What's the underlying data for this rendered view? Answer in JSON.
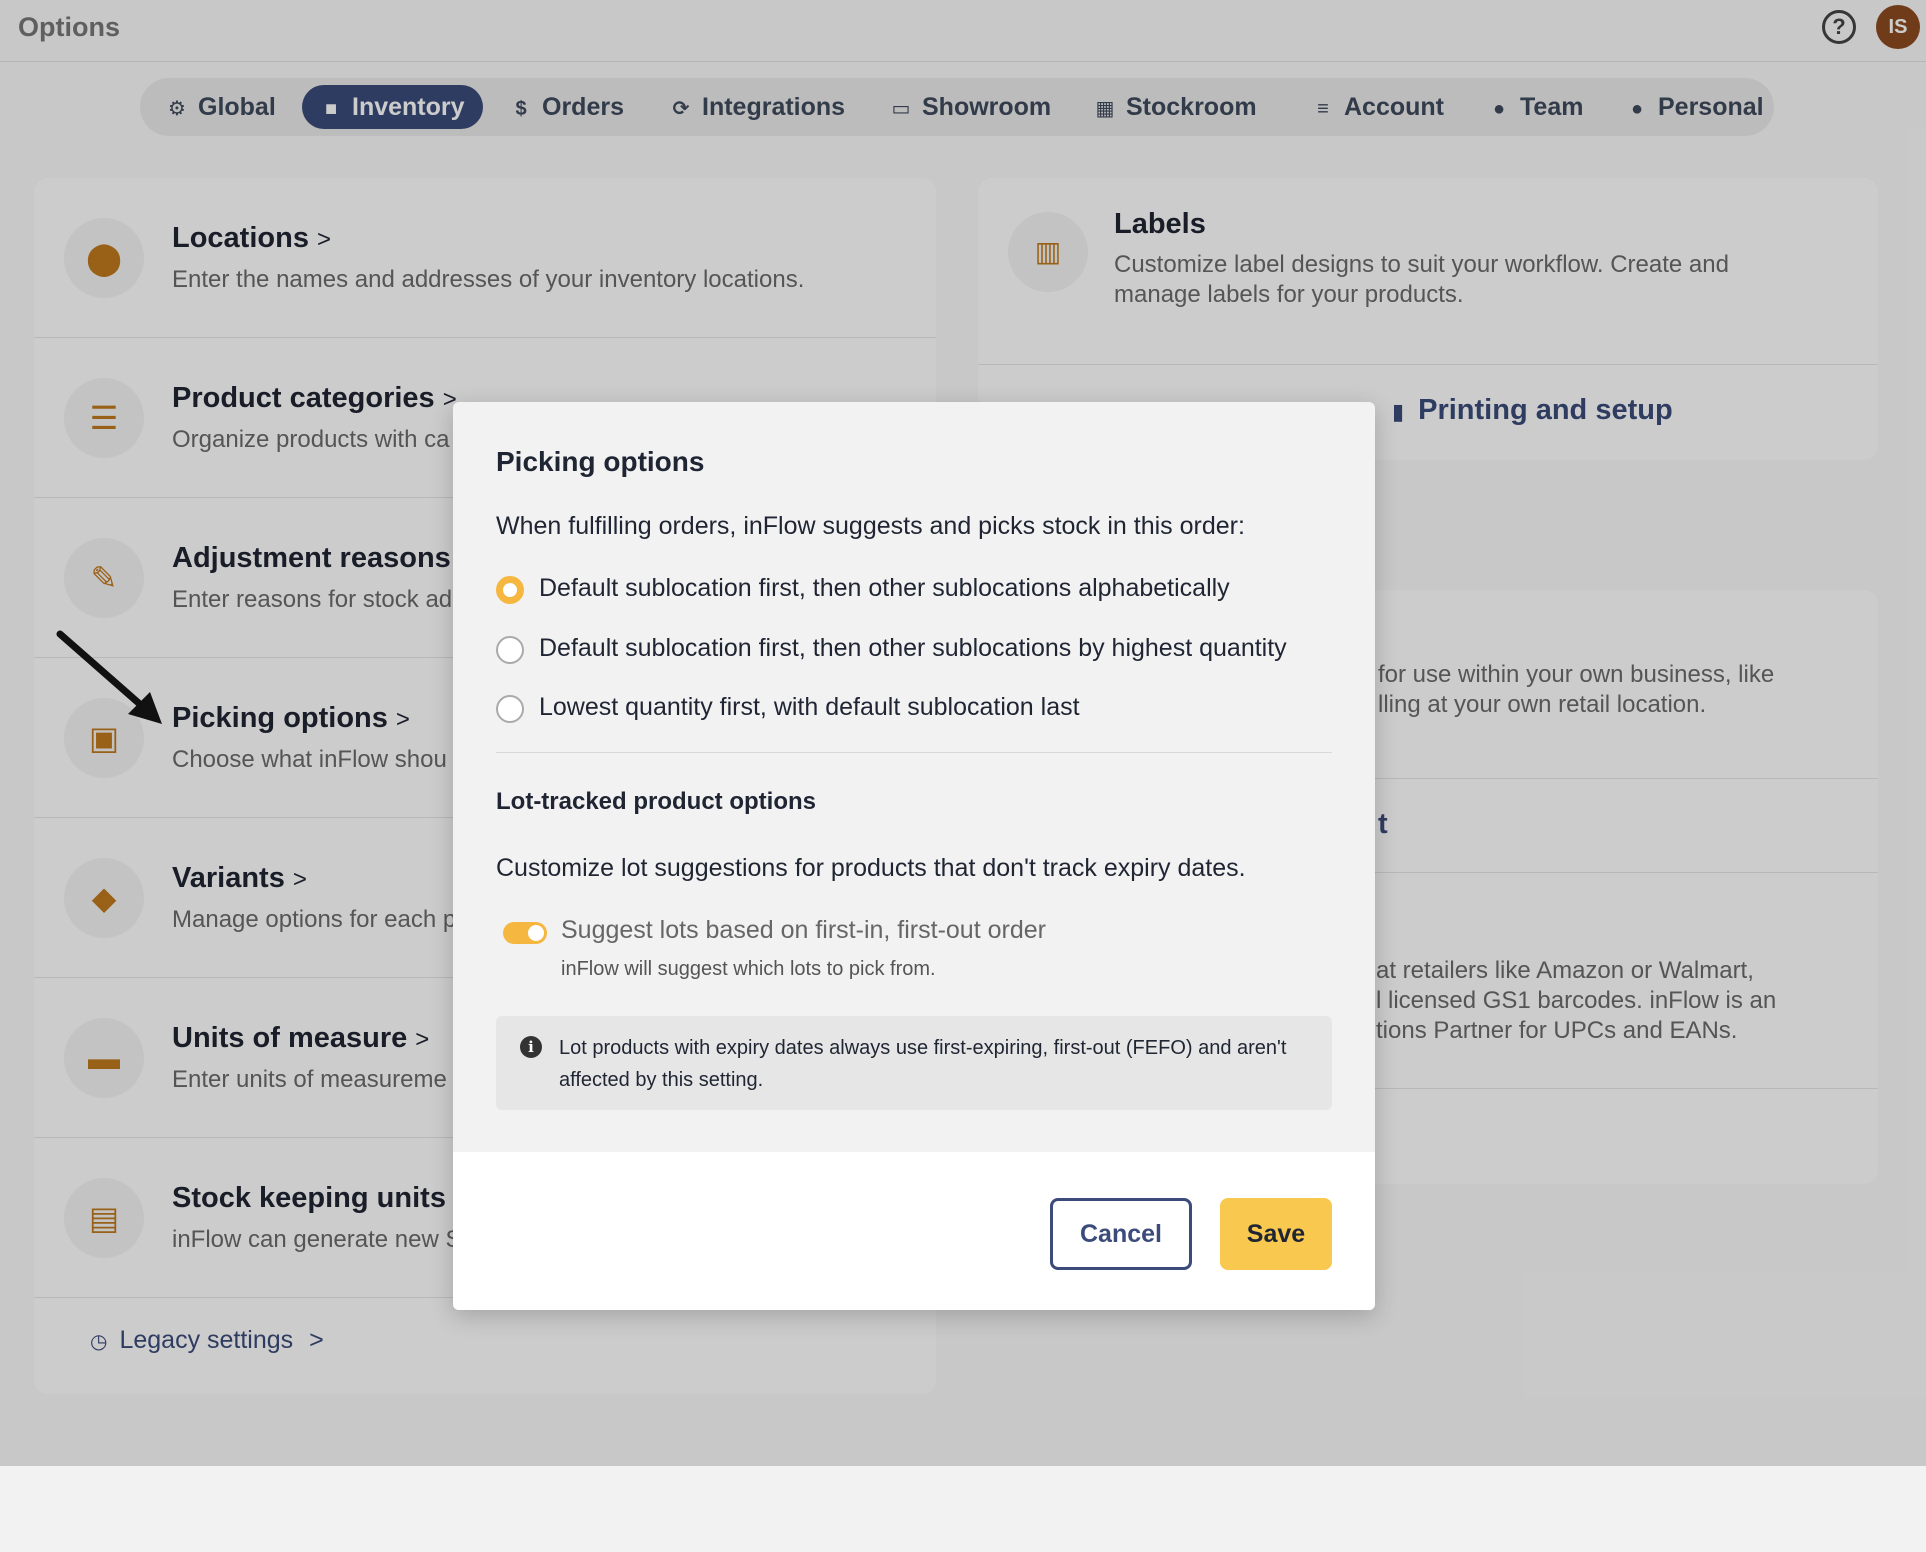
{
  "app": {
    "title": "Options",
    "help_icon": "help-circle-icon",
    "avatar_initials": "IS"
  },
  "tabs": [
    {
      "label": "Global",
      "icon": "gear-icon",
      "glyph": "⚙"
    },
    {
      "label": "Inventory",
      "icon": "box-icon",
      "glyph": "■",
      "active": true
    },
    {
      "label": "Orders",
      "icon": "dollar-icon",
      "glyph": "$"
    },
    {
      "label": "Integrations",
      "icon": "sync-icon",
      "glyph": "⟳"
    },
    {
      "label": "Showroom",
      "icon": "laptop-icon",
      "glyph": "▭"
    },
    {
      "label": "Stockroom",
      "icon": "store-icon",
      "glyph": "▦"
    },
    {
      "label": "Account",
      "icon": "sliders-icon",
      "glyph": "≡"
    },
    {
      "label": "Team",
      "icon": "team-icon",
      "glyph": "●"
    },
    {
      "label": "Personal",
      "icon": "person-icon",
      "glyph": "●"
    }
  ],
  "inventory_settings": [
    {
      "title": "Locations",
      "desc": "Enter the names and addresses of your inventory locations.",
      "icon": "location-pin-icon",
      "glyph": "⬤"
    },
    {
      "title": "Product categories",
      "desc": "Organize products with ca",
      "icon": "list-icon",
      "glyph": "☰"
    },
    {
      "title": "Adjustment reasons",
      "desc": "Enter reasons for stock ad",
      "icon": "pencil-icon",
      "glyph": "✎"
    },
    {
      "title": "Picking options",
      "desc": "Choose what inFlow shou",
      "icon": "picking-icon",
      "glyph": "▣"
    },
    {
      "title": "Variants",
      "desc": "Manage options for each p",
      "icon": "cube-icon",
      "glyph": "◆"
    },
    {
      "title": "Units of measure",
      "desc": "Enter units of measureme",
      "icon": "ruler-icon",
      "glyph": "▬"
    },
    {
      "title": "Stock keeping units (S",
      "desc": "inFlow can generate new S",
      "icon": "document-icon",
      "glyph": "▤"
    }
  ],
  "legacy_settings": "Legacy settings",
  "labels_card": {
    "title": "Labels",
    "desc": "Customize label designs to suit your workflow. Create and manage labels for your products.",
    "link": "Printing and setup",
    "icon": "barcode-label-icon"
  },
  "barcodes_card": {
    "desc_lines": [
      "for use within your own business, like",
      "lling at your own retail location."
    ],
    "link_fragment": "t",
    "desc2_lines": [
      "at retailers like Amazon or Walmart,",
      "l licensed GS1 barcodes. inFlow is an",
      "tions Partner for UPCs and EANs."
    ]
  },
  "modal": {
    "title": "Picking options",
    "intro": "When fulfilling orders, inFlow suggests and picks stock in this order:",
    "options": [
      {
        "label": "Default sublocation first, then other sublocations alphabetically",
        "selected": true
      },
      {
        "label": "Default sublocation first, then other sublocations by highest quantity",
        "selected": false
      },
      {
        "label": "Lowest quantity first, with default sublocation last",
        "selected": false
      }
    ],
    "lot_title": "Lot-tracked product options",
    "lot_desc": "Customize lot suggestions for products that don't track expiry dates.",
    "toggle_label": "Suggest lots based on first-in, first-out order",
    "toggle_help": "inFlow will suggest which lots to pick from.",
    "toggle_on": true,
    "info": "Lot products with expiry dates always use first-expiring, first-out (FEFO) and aren't affected by this setting.",
    "cancel_label": "Cancel",
    "save_label": "Save"
  },
  "colors": {
    "accent_navy": "#3b4b7a",
    "accent_orange": "#c07a1e",
    "toggle_yellow": "#f5b740",
    "save_yellow": "#f9c84f",
    "avatar_brown": "#8b4a1f"
  }
}
